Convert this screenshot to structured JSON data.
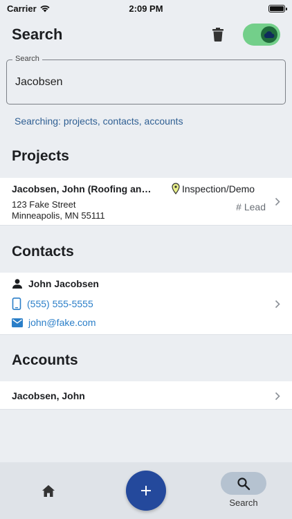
{
  "status_bar": {
    "carrier": "Carrier",
    "time": "2:09 PM"
  },
  "header": {
    "title": "Search",
    "icons": {
      "trash": "trash-icon",
      "sync_toggle": "cloud-icon"
    },
    "sync_enabled": true
  },
  "search": {
    "label": "Search",
    "value": "Jacobsen",
    "hint": "Searching: projects, contacts, accounts"
  },
  "sections": {
    "projects": {
      "title": "Projects",
      "item": {
        "name": "Jacobsen, John (Roofing an…",
        "status": "Inspection/Demo",
        "address_line1": "123 Fake Street",
        "address_line2": "Minneapolis, MN 55111",
        "tag": "# Lead"
      }
    },
    "contacts": {
      "title": "Contacts",
      "item": {
        "name": "John Jacobsen",
        "phone": "(555) 555-5555",
        "email": "john@fake.com"
      }
    },
    "accounts": {
      "title": "Accounts",
      "item": {
        "name": "Jacobsen, John"
      }
    }
  },
  "bottom_nav": {
    "home_icon": "home-icon",
    "add_icon": "plus-icon",
    "search_label": "Search"
  },
  "colors": {
    "background": "#ebeef2",
    "accent_link": "#2a7ec8",
    "hint_text": "#2f5f93",
    "fab": "#24499c",
    "toggle_on": "#73cf8a",
    "status_pin": "#c8d400"
  }
}
